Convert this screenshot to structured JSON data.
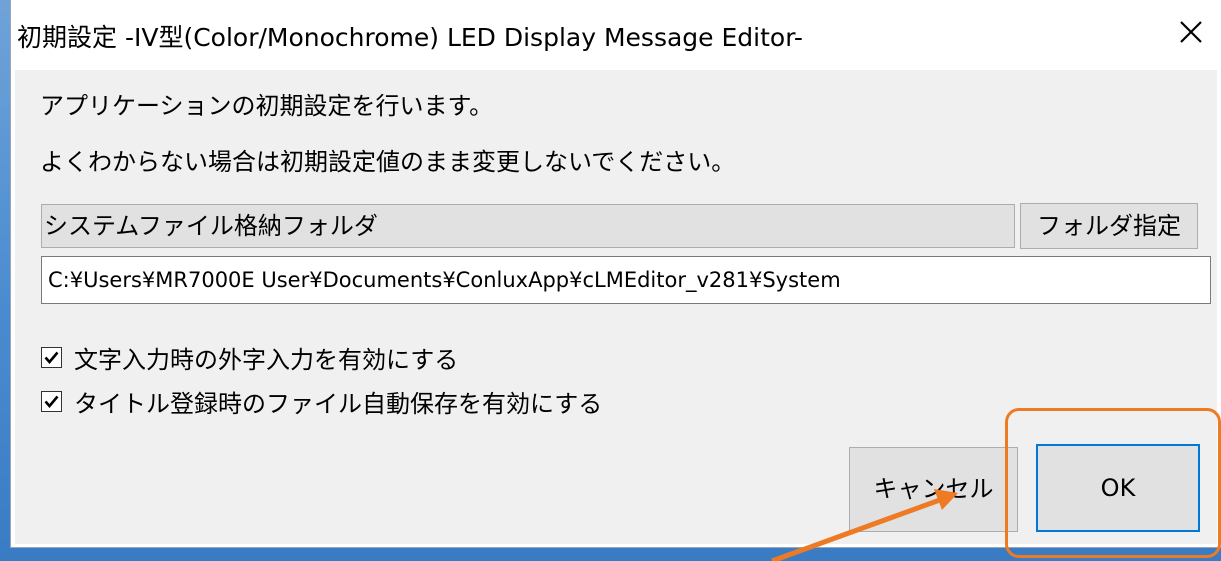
{
  "dialog": {
    "title": "初期設定 -IV型(Color/Monochrome) LED Display Message Editor-",
    "close_glyph": "✕"
  },
  "messages": {
    "line1": "アプリケーションの初期設定を行います。",
    "line2": "よくわからない場合は初期設定値のまま変更しないでください。"
  },
  "folder": {
    "label": "システムファイル格納フォルダ",
    "browse_button": "フォルダ指定",
    "path_value": "C:¥Users¥MR7000E User¥Documents¥ConluxApp¥cLMEditor_v281¥System"
  },
  "options": [
    {
      "label": "文字入力時の外字入力を有効にする",
      "checked": true
    },
    {
      "label": "タイトル登録時のファイル自動保存を有効にする",
      "checked": true
    }
  ],
  "buttons": {
    "cancel": "キャンセル",
    "ok": "OK"
  },
  "annotation": {
    "color": "#ee7a24",
    "highlight_target": "ok-button",
    "arrow_target": "cancel-button"
  },
  "colors": {
    "dialog_face": "#f0f0f0",
    "button_face": "#e1e1e1",
    "focus_border": "#0078d7"
  }
}
